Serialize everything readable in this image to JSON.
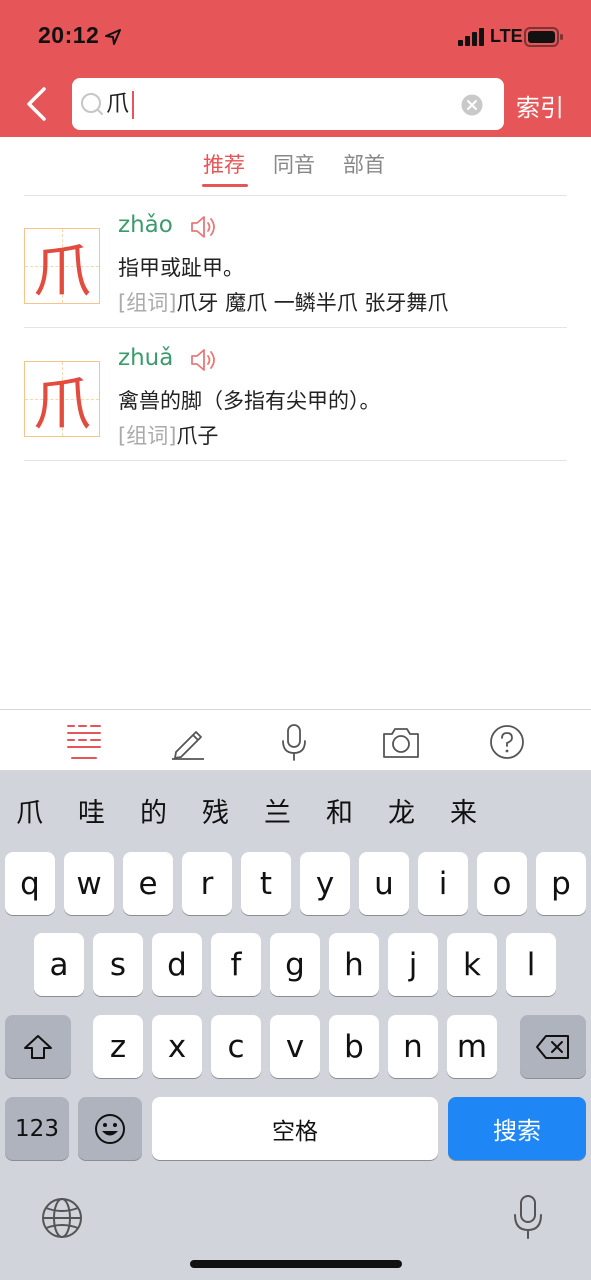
{
  "status_bar": {
    "time": "20:12",
    "network": "LTE"
  },
  "header": {
    "search_value": "爪",
    "index_label": "索引"
  },
  "tabs": [
    {
      "label": "推荐",
      "active": true
    },
    {
      "label": "同音",
      "active": false
    },
    {
      "label": "部首",
      "active": false
    }
  ],
  "results": [
    {
      "character": "爪",
      "pinyin": "zhǎo",
      "definition": "指甲或趾甲。",
      "words_tag": "[组词]",
      "words": "爪牙 魔爪 一鳞半爪 张牙舞爪"
    },
    {
      "character": "爪",
      "pinyin": "zhuǎ",
      "definition": "禽兽的脚（多指有尖甲的）。",
      "words_tag": "[组词]",
      "words": "爪子"
    }
  ],
  "keyboard": {
    "candidates": [
      "爪",
      "哇",
      "的",
      "残",
      "兰",
      "和",
      "龙",
      "来"
    ],
    "row1": [
      "q",
      "w",
      "e",
      "r",
      "t",
      "y",
      "u",
      "i",
      "o",
      "p"
    ],
    "row2": [
      "a",
      "s",
      "d",
      "f",
      "g",
      "h",
      "j",
      "k",
      "l"
    ],
    "row3": [
      "z",
      "x",
      "c",
      "v",
      "b",
      "n",
      "m"
    ],
    "num_label": "123",
    "space_label": "空格",
    "search_label": "搜索"
  },
  "colors": {
    "header_bg": "#e65557",
    "accent": "#e65557",
    "pinyin": "#3c9b6c",
    "search_key": "#1f87f5"
  }
}
